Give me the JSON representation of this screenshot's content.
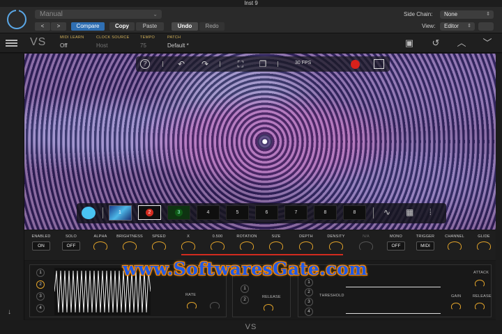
{
  "window": {
    "title": "Inst 9"
  },
  "host": {
    "preset": "Manual",
    "compare": "Compare",
    "copy": "Copy",
    "paste": "Paste",
    "undo": "Undo",
    "redo": "Redo",
    "side_chain_label": "Side Chain:",
    "side_chain_value": "None",
    "view_label": "View:",
    "view_value": "Editor",
    "accent": "#2f6fb3"
  },
  "plugin": {
    "logo": "VS",
    "midi_learn_label": "MIDI LEARN",
    "midi_learn_value": "Off",
    "clock_source_label": "CLOCK SOURCE",
    "clock_source_value": "Host",
    "tempo_label": "TEMPO",
    "tempo_value": "75",
    "patch_label": "PATCH",
    "patch_value": "Default *",
    "icons": [
      "save-icon",
      "revert-icon",
      "chevron-up-icon",
      "chevron-down-icon"
    ]
  },
  "viz_toolbar": {
    "fps": "30 FPS"
  },
  "slots": {
    "thumb_label": "1",
    "items": [
      "2",
      "3",
      "4",
      "5",
      "6",
      "7",
      "8",
      "8"
    ]
  },
  "controls": {
    "enabled_label": "ENABLED",
    "enabled_value": "ON",
    "solo_label": "SOLO",
    "solo_value": "OFF",
    "alpha": "ALPHA",
    "brightness": "BRIGHTNESS",
    "speed": "SPEED",
    "x": "X",
    "y": "0.500",
    "rotation": "ROTATION",
    "size": "SIZE",
    "depth": "DEPTH",
    "density": "DENSITY",
    "na": "N/A",
    "mono_label": "MONO",
    "mono_value": "OFF",
    "trigger_label": "TRIGGER",
    "trigger_value": "MIDI",
    "channel": "CHANNEL",
    "glide": "GLIDE"
  },
  "lower": {
    "lfo_numbers": [
      "1",
      "2",
      "3",
      "4"
    ],
    "env_numbers": [
      "1",
      "2"
    ],
    "seq_numbers": [
      "1",
      "2",
      "3",
      "4"
    ],
    "rate": "RATE",
    "release": "RELEASE",
    "threshold": "THRESHOLD",
    "attack": "ATTACK",
    "gain": "GAIN",
    "release2": "RELEASE"
  },
  "watermark": "www.SoftwaresGate.com",
  "footer": "VS"
}
